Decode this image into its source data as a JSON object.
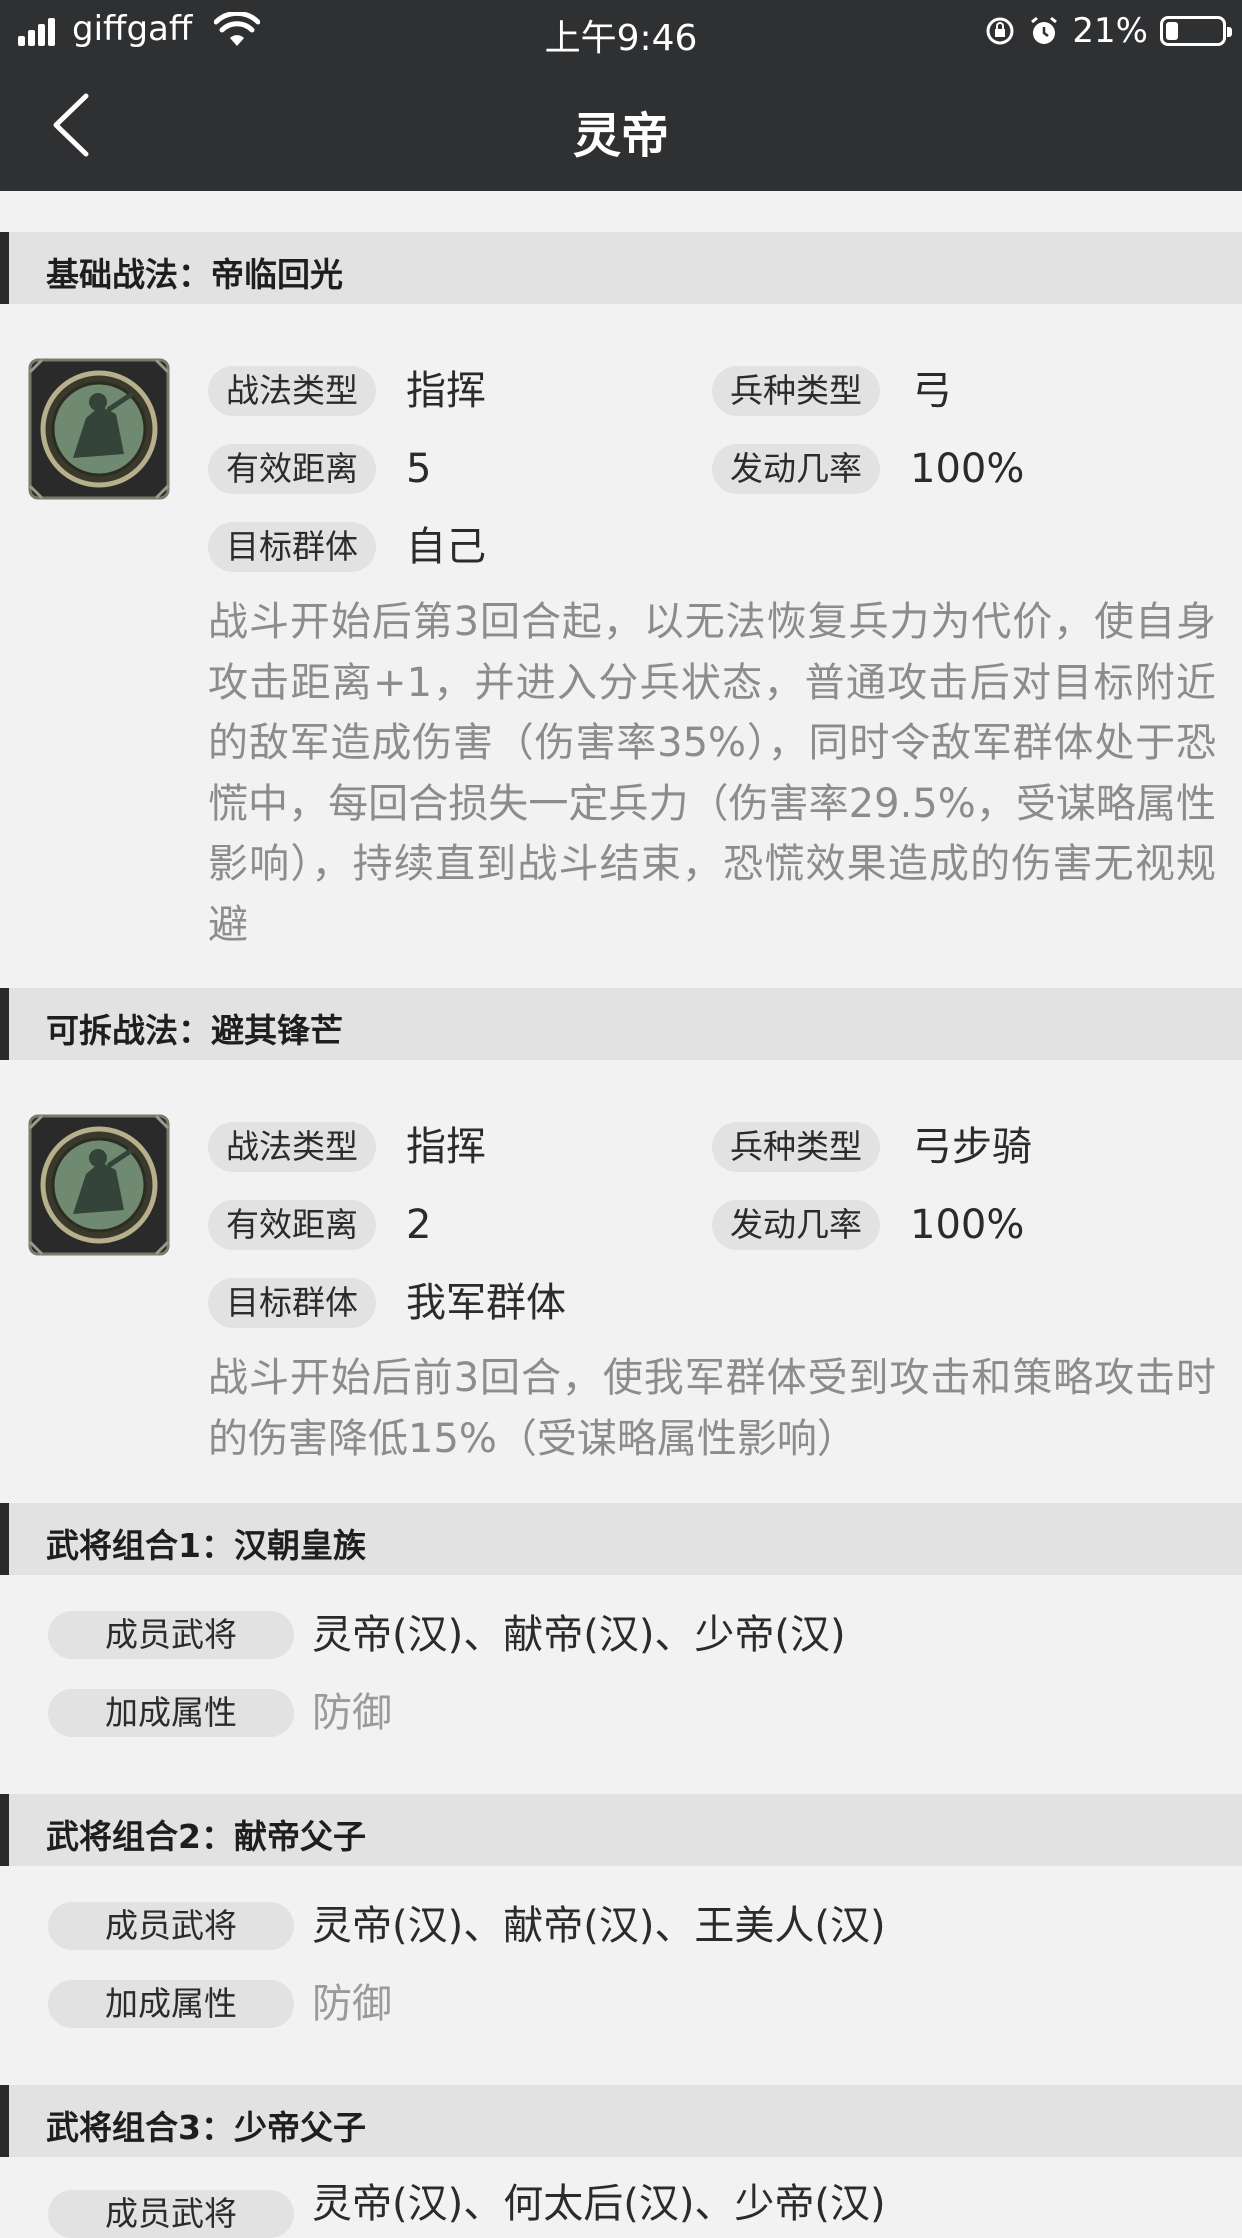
{
  "status_bar": {
    "carrier": "giffgaff",
    "time": "上午9:46",
    "battery": "21%"
  },
  "nav": {
    "title": "灵帝"
  },
  "skills": [
    {
      "header": "基础战法：帝临回光",
      "labels": {
        "type": "战法类型",
        "troop": "兵种类型",
        "range": "有效距离",
        "rate": "发动几率",
        "target": "目标群体"
      },
      "type": "指挥",
      "troop": "弓",
      "range": "5",
      "rate": "100%",
      "target": "自己",
      "description": "战斗开始后第3回合起，以无法恢复兵力为代价，使自身攻击距离+1，并进入分兵状态，普通攻击后对目标附近的敌军造成伤害（伤害率35%），同时令敌军群体处于恐慌中，每回合损失一定兵力（伤害率29.5%，受谋略属性影响），持续直到战斗结束，恐慌效果造成的伤害无视规避"
    },
    {
      "header": "可拆战法：避其锋芒",
      "labels": {
        "type": "战法类型",
        "troop": "兵种类型",
        "range": "有效距离",
        "rate": "发动几率",
        "target": "目标群体"
      },
      "type": "指挥",
      "troop": "弓步骑",
      "range": "2",
      "rate": "100%",
      "target": "我军群体",
      "description": "战斗开始后前3回合，使我军群体受到攻击和策略攻击时的伤害降低15%（受谋略属性影响）"
    }
  ],
  "combos": [
    {
      "header": "武将组合1：汉朝皇族",
      "members_label": "成员武将",
      "members": "灵帝(汉)、献帝(汉)、少帝(汉)",
      "bonus_label": "加成属性",
      "bonus": "防御"
    },
    {
      "header": "武将组合2：献帝父子",
      "members_label": "成员武将",
      "members": "灵帝(汉)、献帝(汉)、王美人(汉)",
      "bonus_label": "加成属性",
      "bonus": "防御"
    },
    {
      "header": "武将组合3：少帝父子",
      "members_label": "成员武将",
      "members": "灵帝(汉)、何太后(汉)、少帝(汉)"
    }
  ]
}
